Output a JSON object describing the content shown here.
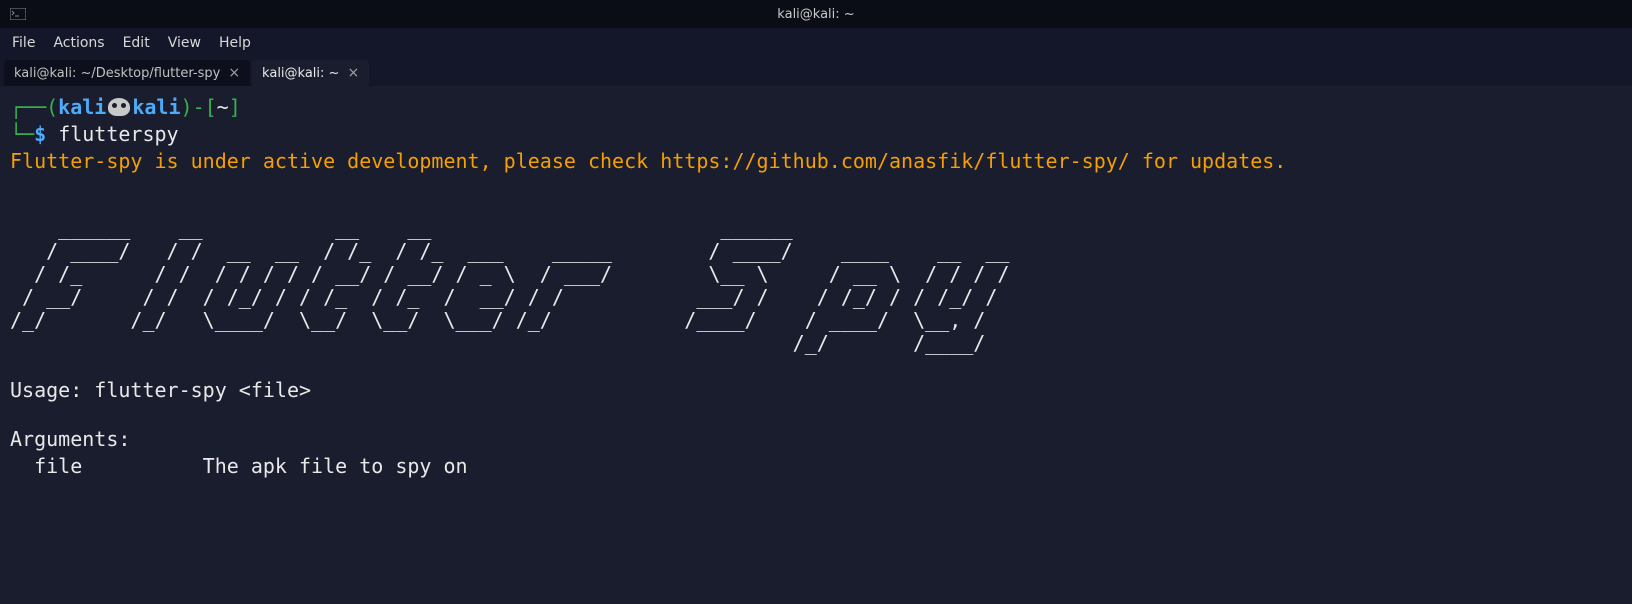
{
  "titlebar": {
    "title": "kali@kali: ~"
  },
  "menubar": {
    "items": [
      "File",
      "Actions",
      "Edit",
      "View",
      "Help"
    ]
  },
  "tabs": [
    {
      "label": "kali@kali: ~/Desktop/flutter-spy",
      "active": false
    },
    {
      "label": "kali@kali: ~",
      "active": true
    }
  ],
  "prompt": {
    "user": "kali",
    "host": "kali",
    "path": "~",
    "symbol": "$",
    "command": "flutterspy"
  },
  "output": {
    "dev_notice": "Flutter-spy is under active development, please check https://github.com/anasfik/flutter-spy/ for updates.",
    "ascii_art": "    ______    __           __    __                        ______\n   / ____/   / /  __  __  / /_  / /_  ___    _____        / ____/    ____    __  __\n  / /_      / /  / / / / / __/ / __/ / _ \\  / ___/        \\__ \\     / __ \\  / / / /\n / __/     / /  / /_/ / / /_  / /_  /  __/ / /           ___/ /    / /_/ / / /_/ /\n/_/       /_/   \\____/  \\__/  \\__/  \\___/ /_/           /____/    / ____/  \\__, /\n                                                                 /_/       /____/",
    "usage_line": "Usage: flutter-spy <file>",
    "arguments_header": "Arguments:",
    "arg_name": "  file",
    "arg_desc": "          The apk file to spy on"
  }
}
